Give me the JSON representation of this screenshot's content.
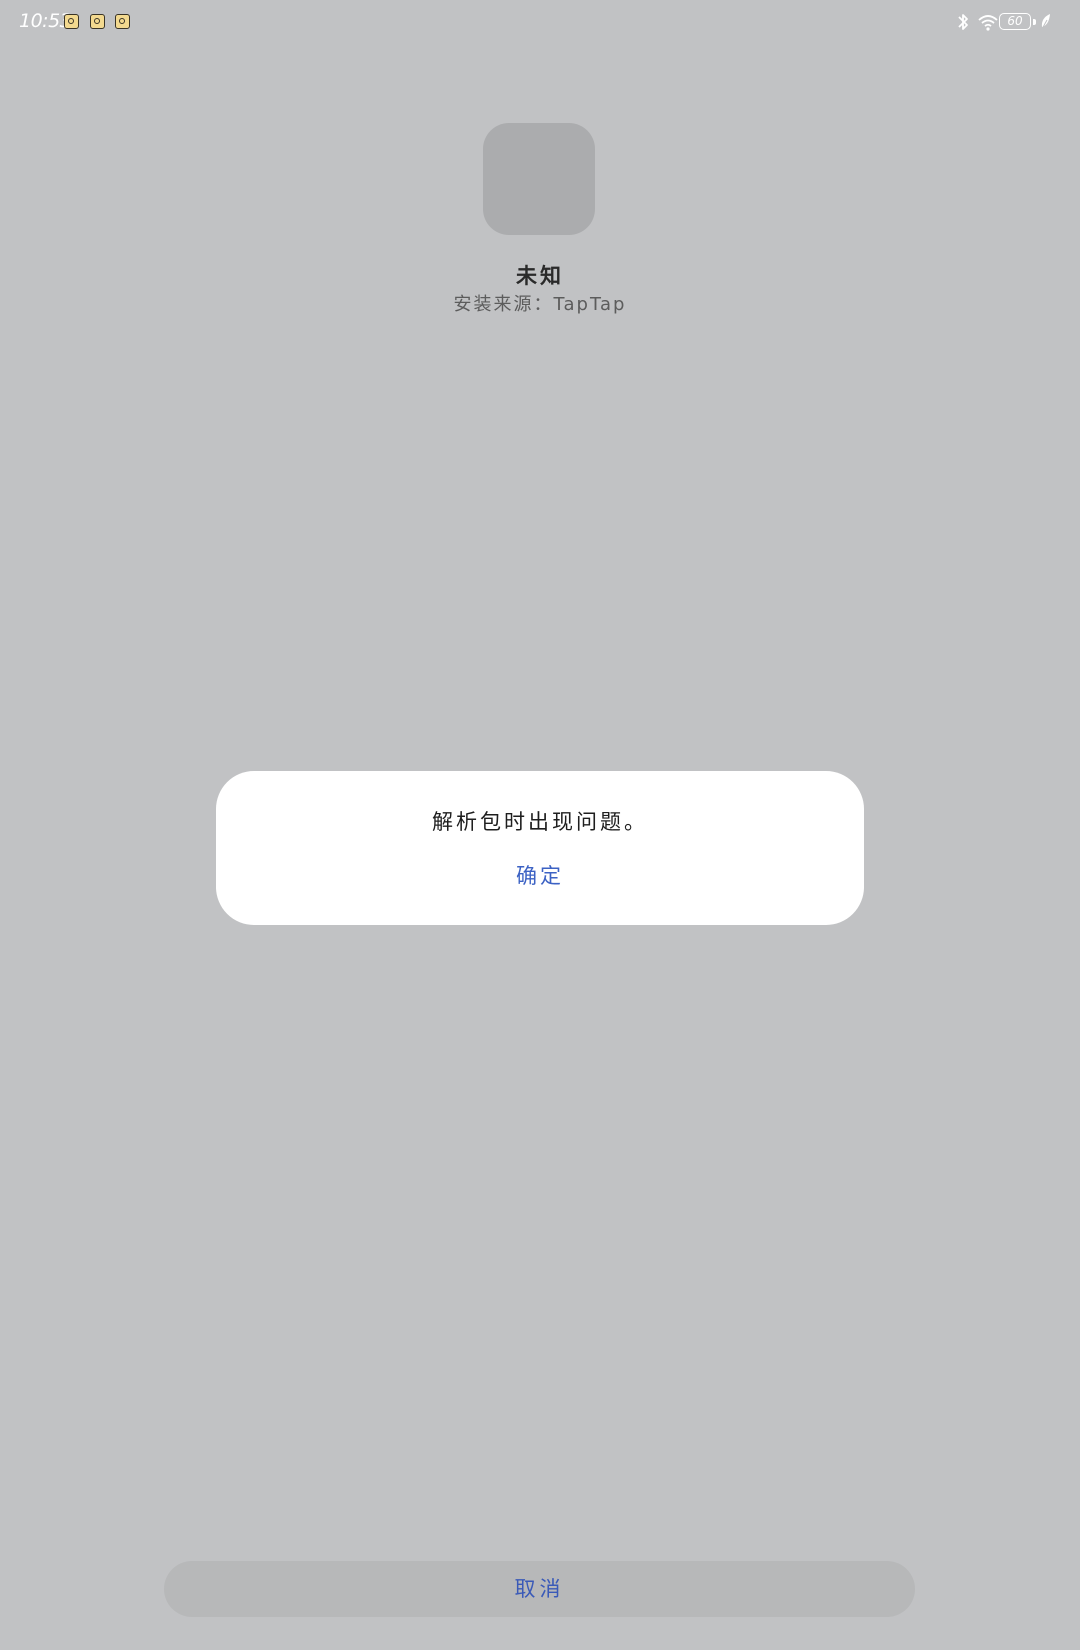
{
  "status_bar": {
    "time": "10:53",
    "battery_level": "60",
    "notification_icons": [
      "app-notification-icon",
      "app-notification-icon",
      "app-notification-icon"
    ],
    "system_icons": [
      "bluetooth-icon",
      "wifi-icon",
      "battery-icon",
      "leaf-icon"
    ]
  },
  "app": {
    "name": "未知",
    "install_source": "安装来源：TapTap"
  },
  "dialog": {
    "message": "解析包时出现问题。",
    "confirm_label": "确定"
  },
  "footer": {
    "cancel_label": "取消"
  },
  "colors": {
    "background": "#c1c2c4",
    "dialog_background": "#ffffff",
    "accent": "#3c62c4"
  }
}
